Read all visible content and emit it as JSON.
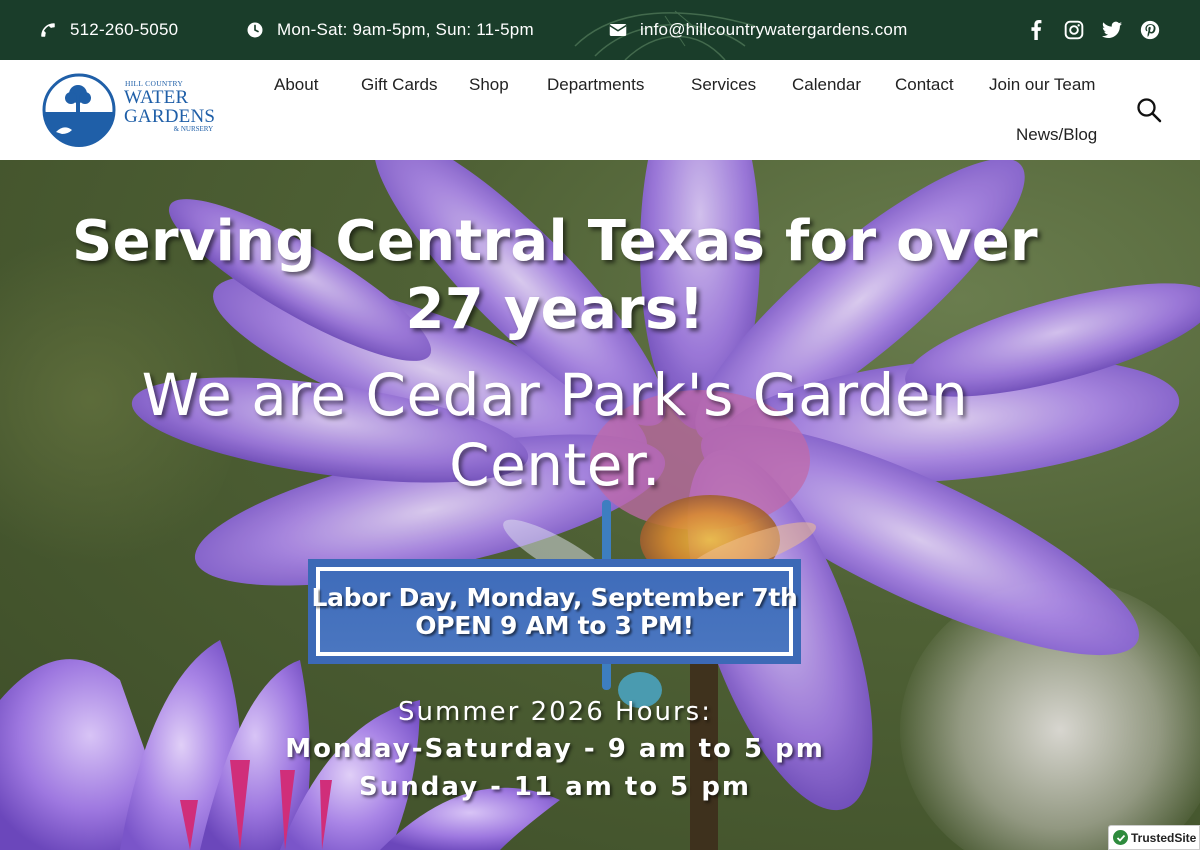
{
  "topbar": {
    "phone": "512-260-5050",
    "hours": "Mon-Sat: 9am-5pm, Sun: 11-5pm",
    "email": "info@hillcountrywatergardens.com",
    "social": [
      "facebook-icon",
      "instagram-icon",
      "twitter-icon",
      "pinterest-icon"
    ]
  },
  "logo": {
    "line1": "HILL COUNTRY",
    "line2": "WATER",
    "line3": "GARDENS",
    "line4": "& NURSERY"
  },
  "nav": {
    "items": [
      "About",
      "Gift Cards",
      "Shop",
      "Departments",
      "Services",
      "Calendar",
      "Contact",
      "Join our Team",
      "News/Blog"
    ]
  },
  "hero": {
    "headline": "Serving Central Texas for over 27 years!",
    "subheadline": "We are Cedar Park's Garden Center.",
    "banner_line1": "Labor Day, Monday, September 7th",
    "banner_line2": "OPEN 9 AM to 3 PM!",
    "hours_title": "Summer 2026 Hours:",
    "hours_weekday": "Monday-Saturday - 9 am to 5 pm",
    "hours_sunday": "Sunday - 11 am to 5 pm"
  },
  "trust_badge": "TrustedSite",
  "colors": {
    "topbar": "#1a3d2a",
    "logo_blue": "#1f5fa8",
    "banner_blue": "#3c69b6",
    "flower_purple": "#9b7ae0"
  }
}
